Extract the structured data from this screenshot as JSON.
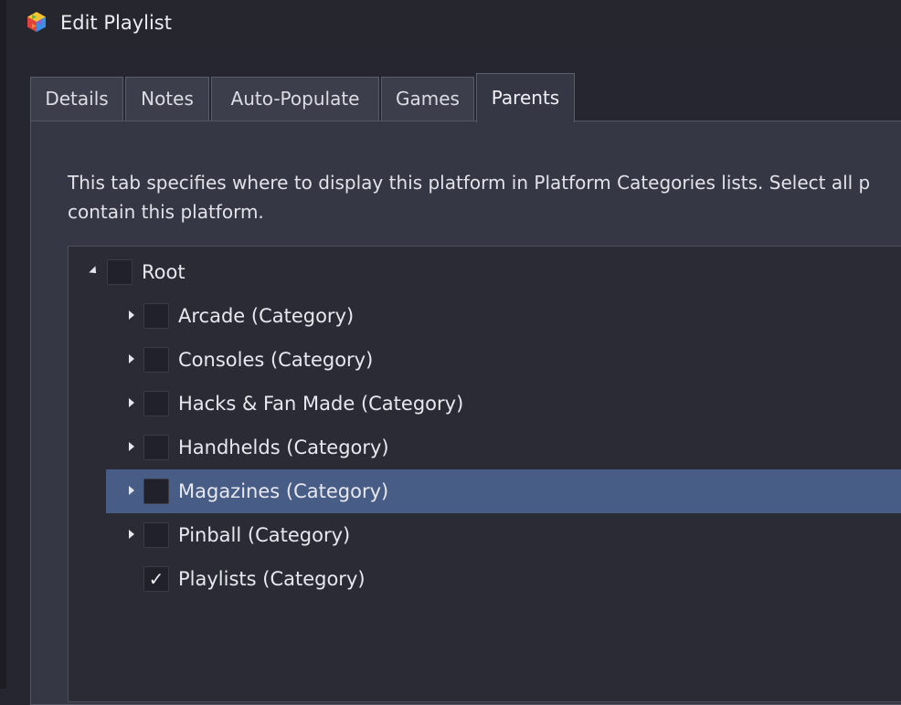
{
  "window": {
    "title": "Edit Playlist",
    "icon": "colorful-cube-icon"
  },
  "tabs": [
    {
      "label": "Details",
      "active": false
    },
    {
      "label": "Notes",
      "active": false
    },
    {
      "label": "Auto-Populate",
      "active": false
    },
    {
      "label": "Games",
      "active": false
    },
    {
      "label": "Parents",
      "active": true
    }
  ],
  "parents_tab": {
    "description_line1": "This tab specifies where to display this platform in Platform Categories lists. Select all p",
    "description_line2": "contain this platform.",
    "tree": {
      "root": {
        "label": "Root",
        "expanded": true,
        "checked": false
      },
      "children": [
        {
          "label": "Arcade (Category)",
          "checked": false,
          "expandable": true,
          "selected": false
        },
        {
          "label": "Consoles (Category)",
          "checked": false,
          "expandable": true,
          "selected": false
        },
        {
          "label": "Hacks & Fan Made (Category)",
          "checked": false,
          "expandable": true,
          "selected": false
        },
        {
          "label": "Handhelds (Category)",
          "checked": false,
          "expandable": true,
          "selected": false
        },
        {
          "label": "Magazines (Category)",
          "checked": false,
          "expandable": true,
          "selected": true
        },
        {
          "label": "Pinball (Category)",
          "checked": false,
          "expandable": true,
          "selected": false
        },
        {
          "label": "Playlists (Category)",
          "checked": true,
          "expandable": false,
          "selected": false
        }
      ]
    }
  },
  "colors": {
    "background": "#262630",
    "panel": "#363744",
    "tree_background": "#2a2b34",
    "selection": "#475d86"
  }
}
